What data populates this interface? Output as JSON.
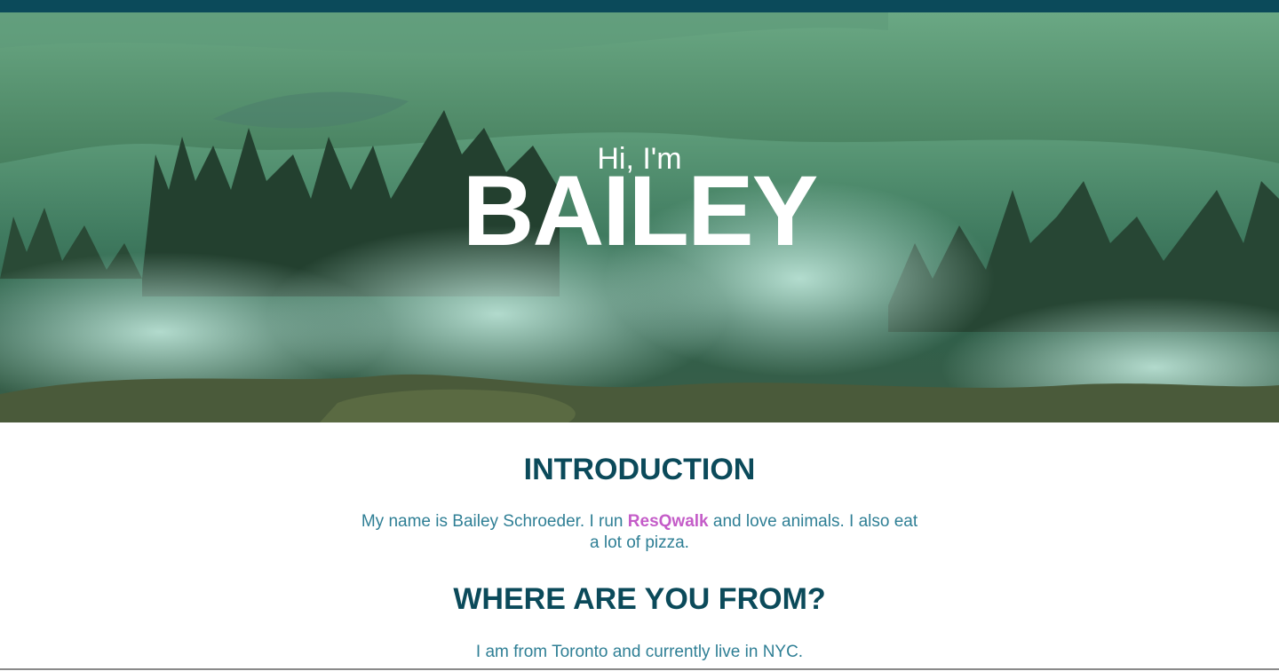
{
  "hero": {
    "greeting": "Hi, I'm",
    "name": "BAILEY"
  },
  "intro": {
    "heading": "INTRODUCTION",
    "text_before": "My name is Bailey Schroeder. I run ",
    "link_label": "ResQwalk",
    "text_after": " and love animals. I also eat a lot of pizza."
  },
  "origin": {
    "heading": "WHERE ARE YOU FROM?",
    "text": "I am from Toronto and currently live in NYC."
  },
  "colors": {
    "topbar": "#0b4a5a",
    "heading": "#0b4a5a",
    "body_text": "#2f7f95",
    "link": "#c45cc8"
  }
}
